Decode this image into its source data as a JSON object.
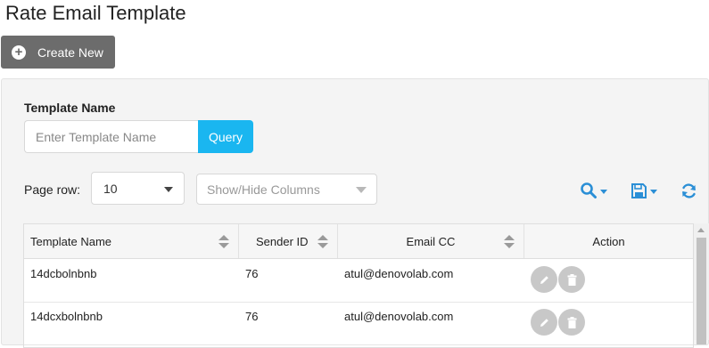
{
  "page": {
    "title": "Rate Email Template"
  },
  "toolbar": {
    "create_label": "Create New"
  },
  "filter": {
    "template_name_label": "Template Name",
    "template_name_placeholder": "Enter Template Name",
    "template_name_value": "",
    "query_label": "Query"
  },
  "pagination": {
    "page_row_label": "Page row:",
    "page_row_value": "10"
  },
  "columns_select": {
    "placeholder": "Show/Hide Columns"
  },
  "colors": {
    "accent": "#1ab6f0",
    "icon_blue": "#2b8fd6",
    "create_button": "#6c6c6c",
    "action_button": "#c8c8c8"
  },
  "icons": {
    "search": "search-icon",
    "save": "save-icon",
    "refresh": "refresh-icon",
    "edit": "pencil-icon",
    "delete": "trash-icon"
  },
  "table": {
    "headers": [
      "Template Name",
      "Sender ID",
      "Email CC",
      "Action"
    ],
    "rows": [
      {
        "template_name": "14dcbolnbnb",
        "sender_id": "76",
        "email_cc": "atul@denovolab.com"
      },
      {
        "template_name": "14dcxbolnbnb",
        "sender_id": "76",
        "email_cc": "atul@denovolab.com"
      }
    ]
  }
}
